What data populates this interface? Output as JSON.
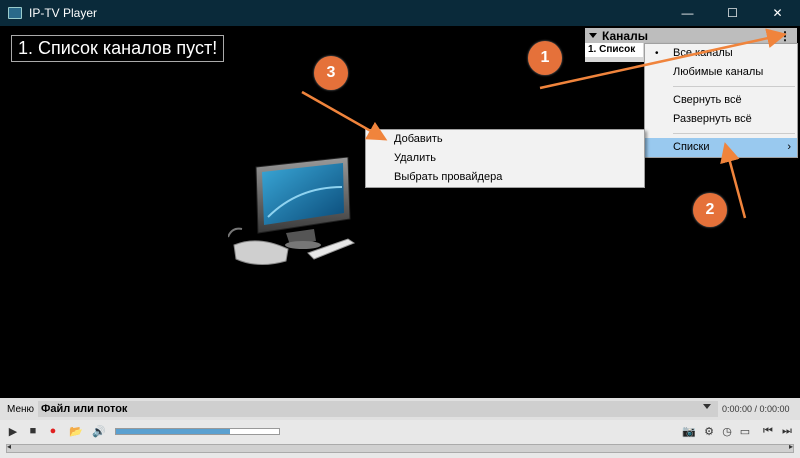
{
  "window": {
    "title": "IP-TV Player",
    "controls": {
      "minimize": "—",
      "maximize": "☐",
      "close": "✕"
    }
  },
  "video": {
    "empty_message": "1. Список каналов пуст!"
  },
  "channels_panel": {
    "title": "Каналы",
    "menu_icon": "⋮",
    "first_row": "1. Список"
  },
  "context_menu_main": {
    "items": [
      {
        "label": "Все каналы",
        "bullet": "•"
      },
      {
        "label": "Любимые каналы"
      },
      {
        "label": "Свернуть всё"
      },
      {
        "label": "Развернуть всё"
      },
      {
        "label": "Списки",
        "submenu_arrow": "›"
      }
    ]
  },
  "context_menu_lists": {
    "items": [
      {
        "label": "Добавить"
      },
      {
        "label": "Удалить"
      },
      {
        "label": "Выбрать провайдера"
      }
    ]
  },
  "badges": [
    "1",
    "2",
    "3"
  ],
  "bottom_bar": {
    "menu_label": "Меню",
    "source_label": "Файл или поток",
    "time": "0:00:00 / 0:00:00",
    "volume_level": 0.7
  },
  "colors": {
    "accent_badge": "#e5713a",
    "highlight": "#99c9ef",
    "titlebar": "#0a2a3a"
  },
  "icons": {
    "play": "▶",
    "stop": "■",
    "record": "●",
    "open": "📂",
    "volume": "🔊",
    "screenshot": "📷",
    "settings": "⚙",
    "timer": "◷",
    "aspect": "▭",
    "prev": "⏮",
    "next": "⏭"
  }
}
